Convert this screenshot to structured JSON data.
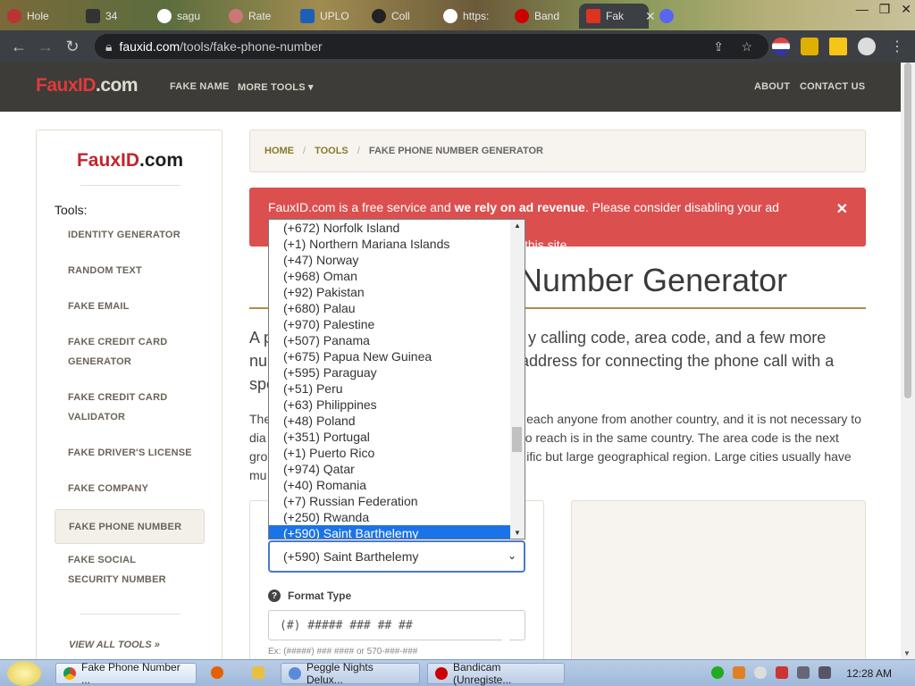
{
  "browser": {
    "tabs": [
      {
        "label": "Hole",
        "active": false
      },
      {
        "label": "sagu",
        "active": false
      },
      {
        "label": "Rate",
        "active": false
      },
      {
        "label": "UPLO",
        "active": false
      },
      {
        "label": "Coll",
        "active": false
      },
      {
        "label": "https:",
        "active": false
      },
      {
        "label": "Band",
        "active": false
      },
      {
        "label": "Fak",
        "active": true
      }
    ],
    "tab_counter": "34",
    "url_host": "fauxid.com",
    "url_path": "/tools/fake-phone-number"
  },
  "site": {
    "logo_brand": "FauxID",
    "logo_domain": ".com",
    "nav": {
      "fake_name": "FAKE NAME",
      "more_tools": "MORE TOOLS",
      "about": "ABOUT",
      "contact": "CONTACT US"
    },
    "sidebar": {
      "logo_brand": "FauxID",
      "logo_domain": ".com",
      "title": "Tools:",
      "items": [
        "IDENTITY GENERATOR",
        "RANDOM TEXT",
        "FAKE EMAIL",
        "FAKE CREDIT CARD GENERATOR",
        "FAKE CREDIT CARD VALIDATOR",
        "FAKE DRIVER'S LICENSE",
        "FAKE COMPANY",
        "FAKE PHONE NUMBER",
        "FAKE SOCIAL SECURITY NUMBER"
      ],
      "active_item": "FAKE PHONE NUMBER",
      "view_all": "VIEW ALL TOOLS »"
    },
    "breadcrumb": {
      "home": "HOME",
      "tools": "TOOLS",
      "current": "FAKE PHONE NUMBER GENERATOR",
      "separator": "/"
    },
    "adblock": {
      "text_start": "FauxID.com is a free service and ",
      "text_bold": "we rely on ad revenue",
      "text_end": ". Please consider disabling your ad blocker",
      "text_line2": "this site."
    },
    "heading_visible": "Number Generator",
    "lead": {
      "line1_left": "A p",
      "line1_right": "y calling code, area code, and a few more",
      "line2_left": "nu",
      "line2_right": "address for connecting the phone call with a",
      "line3_left": "spe"
    },
    "body": {
      "l1_left": "The",
      "l1_right": "each anyone from another country, and it is not necessary to",
      "l2_left": "dia",
      "l2_right": "o reach is in the same country. The area code is the next",
      "l3_left": "gro",
      "l3_right": "ific but large geographical region. Large cities usually have",
      "l4_left": "mu"
    },
    "country_select": {
      "value": "(+590) Saint Barthelemy",
      "options": [
        "(+672) Norfolk Island",
        "(+1) Northern Mariana Islands",
        "(+47) Norway",
        "(+968) Oman",
        "(+92) Pakistan",
        "(+680) Palau",
        "(+970) Palestine",
        "(+507) Panama",
        "(+675) Papua New Guinea",
        "(+595) Paraguay",
        "(+51) Peru",
        "(+63) Philippines",
        "(+48) Poland",
        "(+351) Portugal",
        "(+1) Puerto Rico",
        "(+974) Qatar",
        "(+40) Romania",
        "(+7) Russian Federation",
        "(+250) Rwanda",
        "(+590) Saint Barthelemy"
      ],
      "selected_index": 19
    },
    "format": {
      "label": "Format Type",
      "value": "(#) ##### ### ## ##",
      "help": "Ex: (#####) ### #### or 570-###-###"
    }
  },
  "taskbar": {
    "items": [
      {
        "label": "Fake Phone Number ...",
        "active": true
      },
      {
        "label": "Peggle Nights Delux...",
        "active": false
      },
      {
        "label": "Bandicam (Unregiste...",
        "active": false
      }
    ],
    "clock": "12:28 AM"
  },
  "colors": {
    "accent_red": "#dc4f4f",
    "brand_red": "#c0262c",
    "nav_bg": "#3d3c38",
    "select_highlight": "#1a73e8",
    "heading_rule": "#b58a4a"
  }
}
